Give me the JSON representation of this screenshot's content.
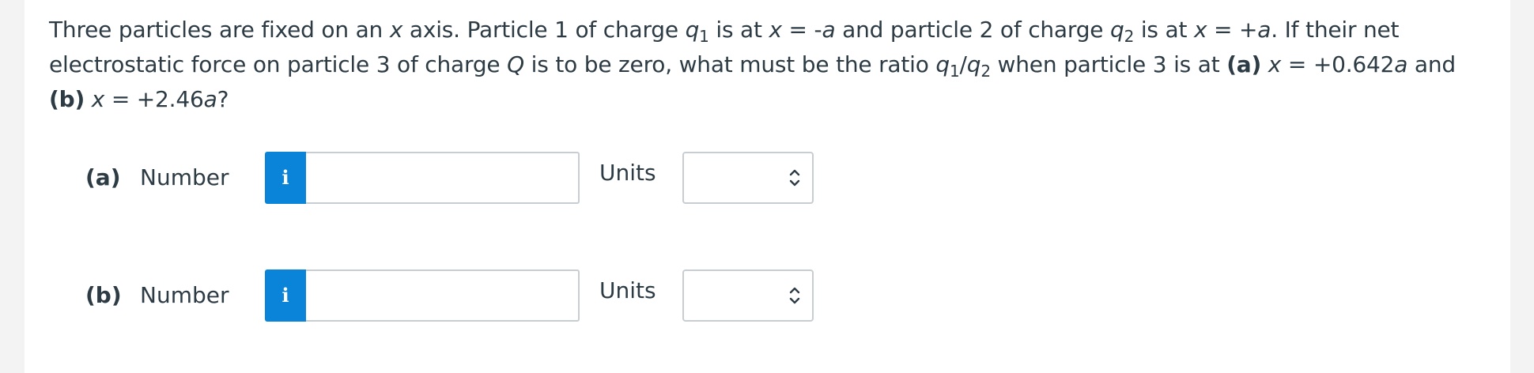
{
  "question": {
    "s1": "Three particles are fixed on an ",
    "s2": "x",
    "s3": " axis. Particle 1 of charge ",
    "s4": "q",
    "s5": "1",
    "s6": " is at ",
    "s7": "x",
    "s8": " = -",
    "s9": "a",
    "s10": " and particle 2 of charge ",
    "s11": "q",
    "s12": "2",
    "s13": " is at ",
    "s14": "x",
    "s15": " = +",
    "s16": "a",
    "s17": ". If their net electrostatic force on particle 3 of charge ",
    "s18": "Q",
    "s19": " is to be zero, what must be the ratio ",
    "s20": "q",
    "s21": "1",
    "s22": "/",
    "s23": "q",
    "s24": "2",
    "s25": " when particle 3 is at ",
    "s26": "(a)",
    "s27": " ",
    "s28": "x",
    "s29": " = +0.642",
    "s30": "a",
    "s31": " and ",
    "s32": "(b)",
    "s33": " ",
    "s34": "x",
    "s35": " = +2.46",
    "s36": "a",
    "s37": "?"
  },
  "parts": [
    {
      "label": "(a)",
      "number_label": "Number",
      "info_icon": "i",
      "number_value": "",
      "units_label": "Units",
      "units_selected": ""
    },
    {
      "label": "(b)",
      "number_label": "Number",
      "info_icon": "i",
      "number_value": "",
      "units_label": "Units",
      "units_selected": ""
    }
  ],
  "icons": {
    "info": "info-icon",
    "select": "chevron-updown-icon"
  },
  "colors": {
    "info_button": "#0a84d8",
    "text": "#2d3b45",
    "border": "#c7cdd1"
  }
}
